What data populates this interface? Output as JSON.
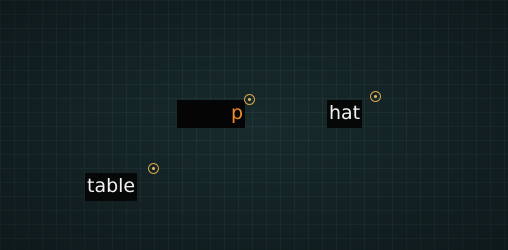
{
  "game": {
    "words": [
      {
        "id": "typed",
        "text": "p",
        "state": "typing"
      },
      {
        "id": "hat",
        "text": "hat",
        "state": "idle"
      },
      {
        "id": "table",
        "text": "table",
        "state": "idle"
      }
    ],
    "colors": {
      "grid_bg": "#132124",
      "tag_bg": "#060707",
      "idle_text": "#f2f2f2",
      "active_text": "#f08a2a",
      "marker": "#d9a445"
    },
    "marker_icon": "target-reticle-icon"
  }
}
